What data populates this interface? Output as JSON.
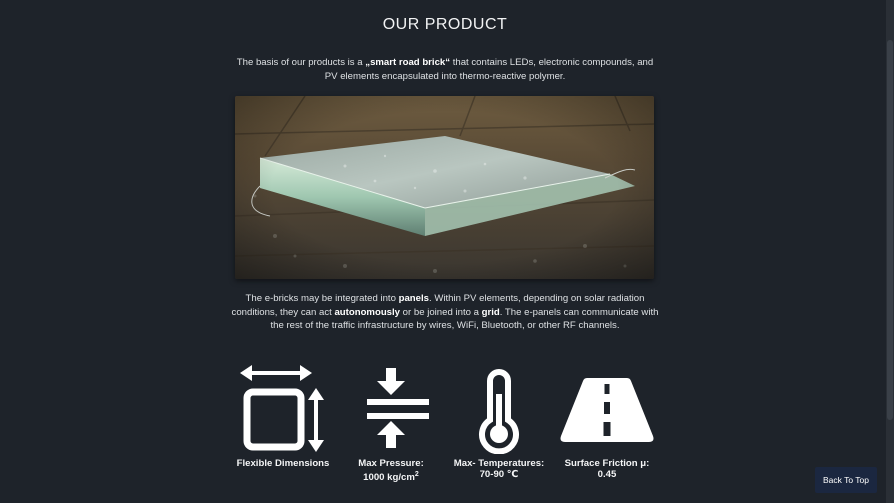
{
  "section": {
    "title": "OUR PRODUCT"
  },
  "intro": {
    "pre": "The basis of our products is a ",
    "bold": "„smart road brick“",
    "post": " that contains LEDs, electronic compounds, and PV elements encapsulated into thermo-reactive polymer."
  },
  "description": {
    "part1": "The e-bricks may be integrated into ",
    "bold1": "panels",
    "part2": ". Within PV elements, depending on solar radiation conditions, they can act ",
    "bold2": "autonomously",
    "part3": " or be joined into a ",
    "bold3": "grid",
    "part4": ". The e-panels can communicate with the rest of the traffic infrastructure by wires, WiFi, Bluetooth, or other RF channels."
  },
  "features": [
    {
      "icon": "dimensions-icon",
      "label": "Flexible Dimensions",
      "value": ""
    },
    {
      "icon": "pressure-icon",
      "label": "Max Pressure:",
      "value": "1000 kg/cm",
      "sup": "2"
    },
    {
      "icon": "thermometer-icon",
      "label": "Max- Temperatures:",
      "value": "70-90 ℃"
    },
    {
      "icon": "road-icon",
      "label": "Surface Friction μ:",
      "value": "0.45"
    }
  ],
  "back_to_top": "Back To Top",
  "colors": {
    "background": "#1e232a",
    "button": "#1b2740",
    "text": "#e6e8ea"
  }
}
